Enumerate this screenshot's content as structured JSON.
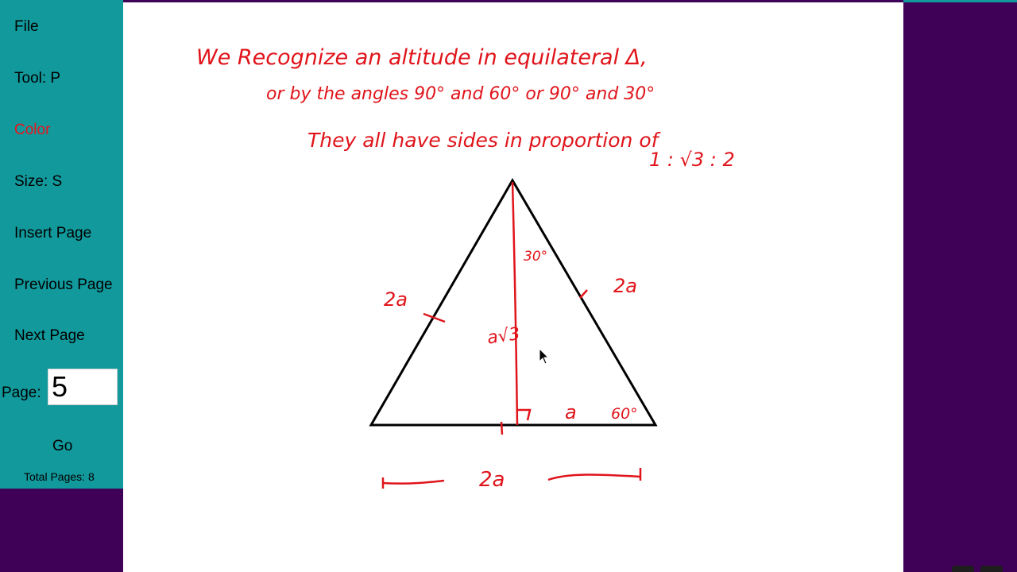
{
  "sidebar": {
    "file_label": "File",
    "tool_label": "Tool: P",
    "color_label": "Color",
    "color_value": "#e8141b",
    "size_label": "Size: S",
    "insert_page_label": "Insert Page",
    "previous_page_label": "Previous Page",
    "next_page_label": "Next Page",
    "page_label": "Page:",
    "page_value": "5",
    "go_label": "Go",
    "total_pages_label": "Total Pages: 8"
  },
  "canvas": {
    "notes": {
      "line1": "We Recognize an altitude in equilateral Δ,",
      "line2": "or by the angles 90° and 60° or 90° and 30°",
      "line3": "They all have sides in proportion of",
      "ratio": "1 : √3 : 2"
    },
    "triangle_labels": {
      "left_side": "2a",
      "right_side": "2a",
      "top_angle": "30°",
      "altitude": "a√3",
      "half_base": "a",
      "bottom_angle": "60°",
      "base": "2a"
    }
  },
  "colors": {
    "sidebar_bg": "#12999c",
    "background": "#3f0057",
    "ink": "#e0141b"
  }
}
